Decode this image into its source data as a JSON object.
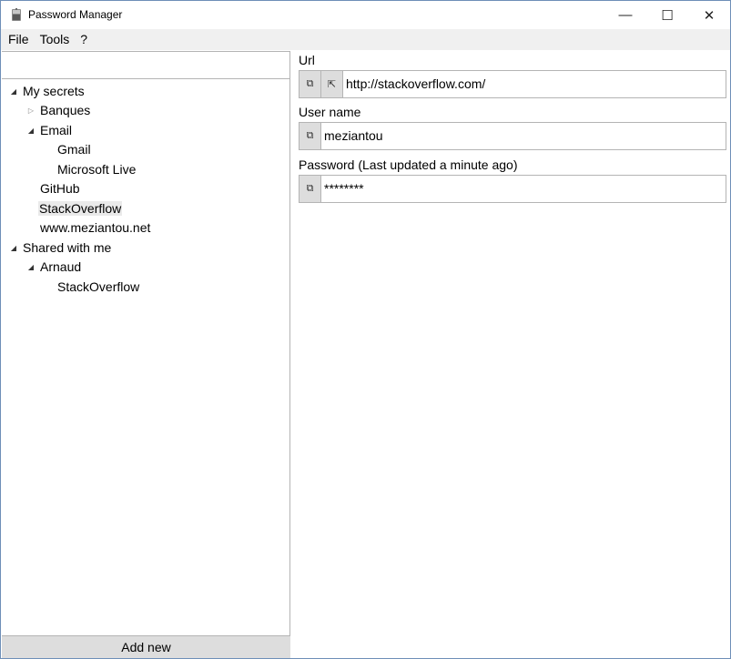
{
  "window": {
    "title": "Password Manager",
    "minimize_glyph": "—",
    "maximize_glyph": "☐",
    "close_glyph": "✕"
  },
  "menu": {
    "items": [
      {
        "label": "File"
      },
      {
        "label": "Tools"
      },
      {
        "label": "?"
      }
    ]
  },
  "sidebar": {
    "search": {
      "value": "",
      "placeholder": ""
    },
    "tree": [
      {
        "label": "My secrets",
        "expanded": true,
        "selected": false
      },
      {
        "label": "Banques",
        "expanded": false,
        "selected": false
      },
      {
        "label": "Email",
        "expanded": true,
        "selected": false
      },
      {
        "label": "Gmail",
        "selected": false
      },
      {
        "label": "Microsoft Live",
        "selected": false
      },
      {
        "label": "GitHub",
        "selected": false
      },
      {
        "label": "StackOverflow",
        "selected": true
      },
      {
        "label": "www.meziantou.net",
        "selected": false
      },
      {
        "label": "Shared with me",
        "expanded": true,
        "selected": false
      },
      {
        "label": "Arnaud",
        "expanded": true,
        "selected": false
      },
      {
        "label": "StackOverflow",
        "selected": false
      }
    ],
    "add_new_label": "Add new"
  },
  "details": {
    "url": {
      "label": "Url",
      "value": "http://stackoverflow.com/"
    },
    "username": {
      "label": "User name",
      "value": "meziantou"
    },
    "password": {
      "label": "Password (Last updated a minute ago)",
      "value": "********"
    }
  },
  "icons": {
    "copy": "⧉",
    "open_link": "⇱",
    "expanded": "◢",
    "collapsed": "▷"
  }
}
